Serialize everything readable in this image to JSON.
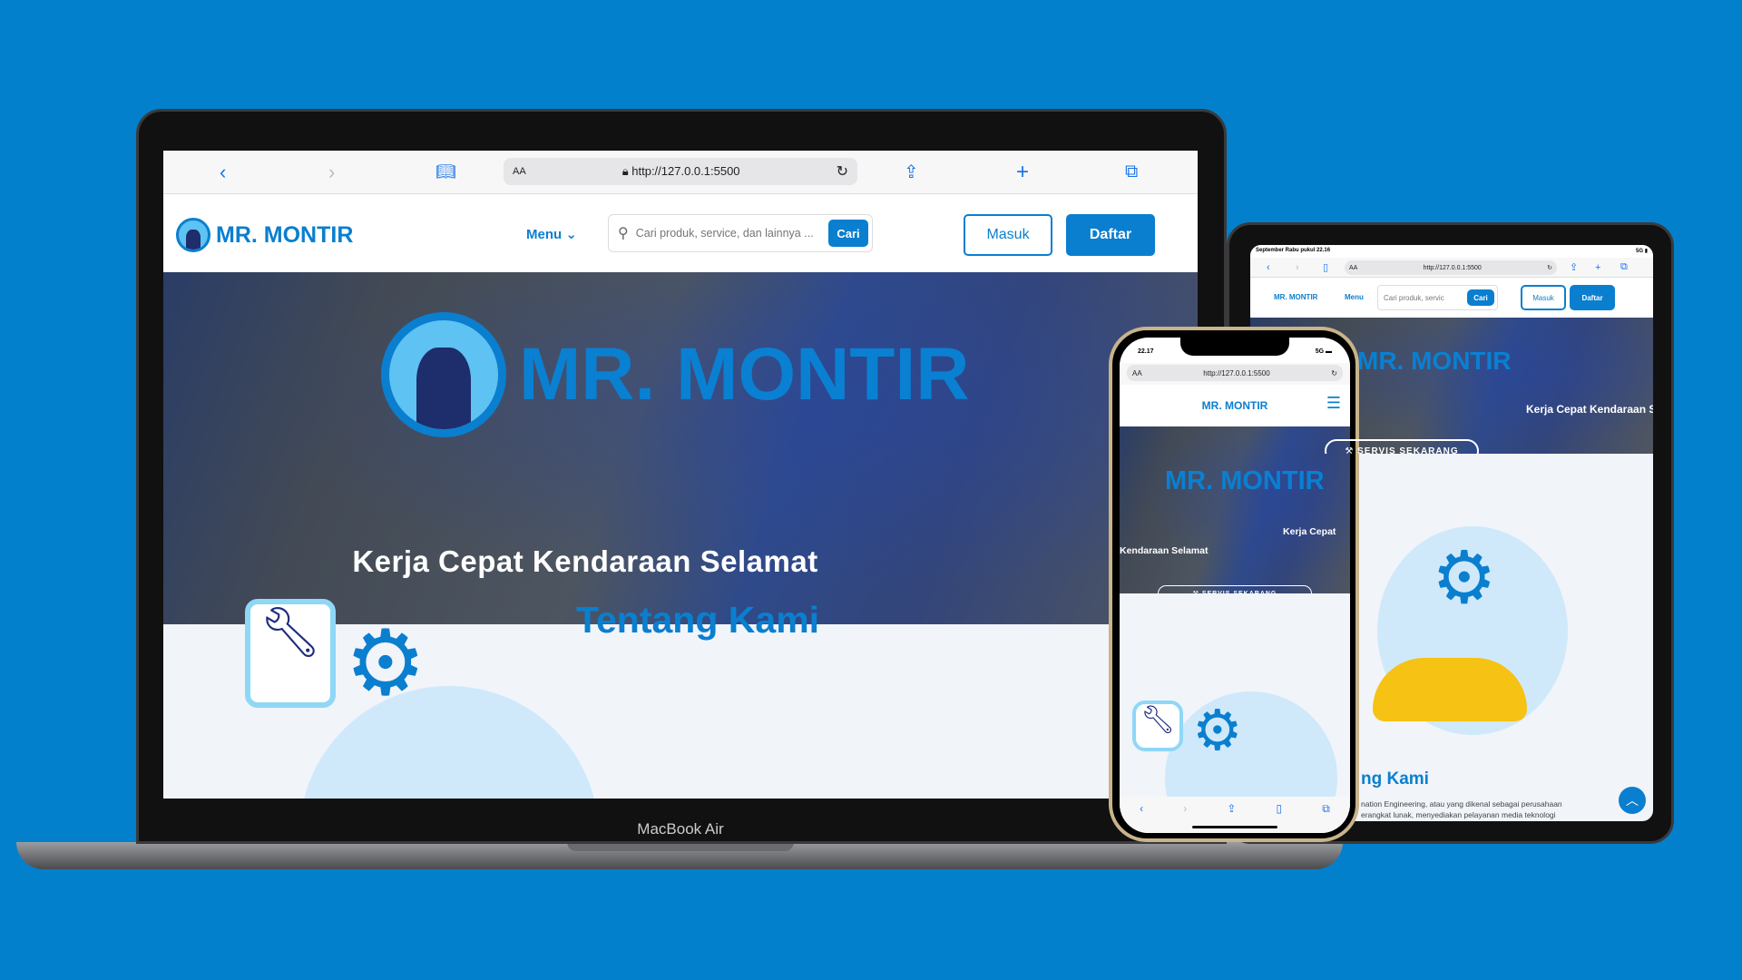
{
  "brand": "MR. MONTIR",
  "colors": {
    "background": "#0280cc",
    "brand": "#0a7fcf"
  },
  "browser": {
    "url": "http://127.0.0.1:5500",
    "aa": "AA",
    "icons": [
      "chevron-left-icon",
      "chevron-right-icon",
      "book-icon",
      "lock-icon",
      "reload-icon",
      "share-icon",
      "plus-icon",
      "tabs-icon"
    ]
  },
  "nav": {
    "menu": "Menu",
    "search_placeholder": "Cari produk, service, dan lainnya ...",
    "search_placeholder_short": "Cari produk, servic",
    "search_button": "Cari",
    "login": "Masuk",
    "register": "Daftar"
  },
  "hero": {
    "title": "MR. MONTIR",
    "tagline": "Kerja Cepat Kendaraan Selamat",
    "cta": "SERVIS SEKARANG"
  },
  "about": {
    "title": "Tentang Kami",
    "title_partial": "ng Kami",
    "text_line1": "nation Engineering, atau yang dikenal sebagai perusahaan",
    "text_line2": "erangkat lunak, menyediakan pelayanan media teknologi"
  },
  "laptop": {
    "label": "MacBook Air"
  },
  "tablet": {
    "status_time": "September Rabu pukul 22.16",
    "status_signal": "5G"
  },
  "phone": {
    "status_time": "22.17",
    "status_signal": "5G"
  }
}
